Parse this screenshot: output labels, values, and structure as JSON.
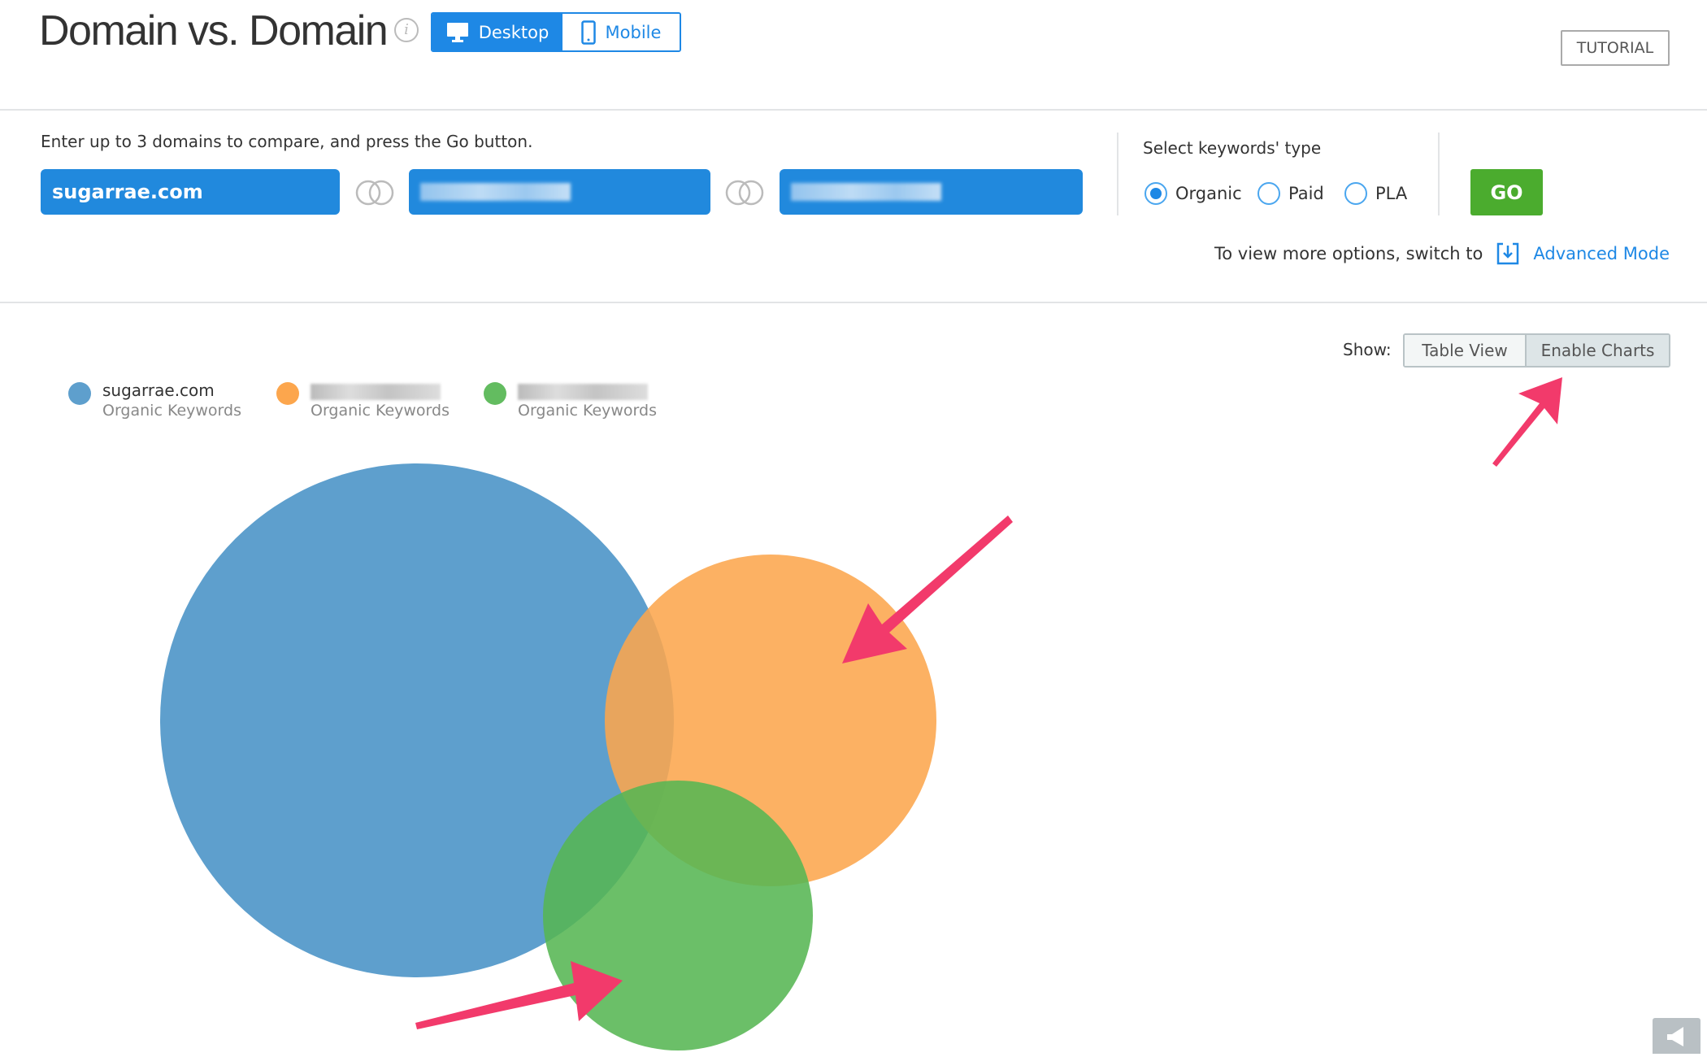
{
  "header": {
    "title": "Domain vs. Domain",
    "info_icon": "info-icon",
    "device_tabs": [
      {
        "label": "Desktop",
        "icon": "desktop-icon",
        "active": true
      },
      {
        "label": "Mobile",
        "icon": "mobile-icon",
        "active": false
      }
    ],
    "tutorial_label": "TUTORIAL"
  },
  "form": {
    "instruction": "Enter up to 3 domains to compare, and press the Go button.",
    "domains": [
      {
        "value": "sugarrae.com"
      },
      {
        "value": "",
        "blurred": true
      },
      {
        "value": "",
        "blurred": true
      }
    ],
    "overlap_icon": "venn-intersect-icon",
    "keyword_type_label": "Select keywords' type",
    "keyword_types": [
      {
        "label": "Organic",
        "selected": true
      },
      {
        "label": "Paid",
        "selected": false
      },
      {
        "label": "PLA",
        "selected": false
      }
    ],
    "go_label": "GO",
    "advanced_prefix": "To view more options, switch to",
    "advanced_link": "Advanced Mode",
    "advanced_icon": "download-box-icon"
  },
  "view": {
    "show_label": "Show:",
    "options": [
      {
        "label": "Table View",
        "active": false
      },
      {
        "label": "Enable Charts",
        "active": true
      }
    ]
  },
  "legend": [
    {
      "domain": "sugarrae.com",
      "metric": "Organic Keywords",
      "color": "#5e9fcd"
    },
    {
      "domain": "",
      "blurred": true,
      "metric": "Organic Keywords",
      "color": "#fca64d"
    },
    {
      "domain": "",
      "blurred": true,
      "metric": "Organic Keywords",
      "color": "#63bc60"
    }
  ],
  "colors": {
    "accent": "#1e88e5",
    "go": "#4bac2e",
    "annotation_arrow": "#f23a6b"
  },
  "footer": {
    "speaker_icon": "megaphone-icon"
  }
}
